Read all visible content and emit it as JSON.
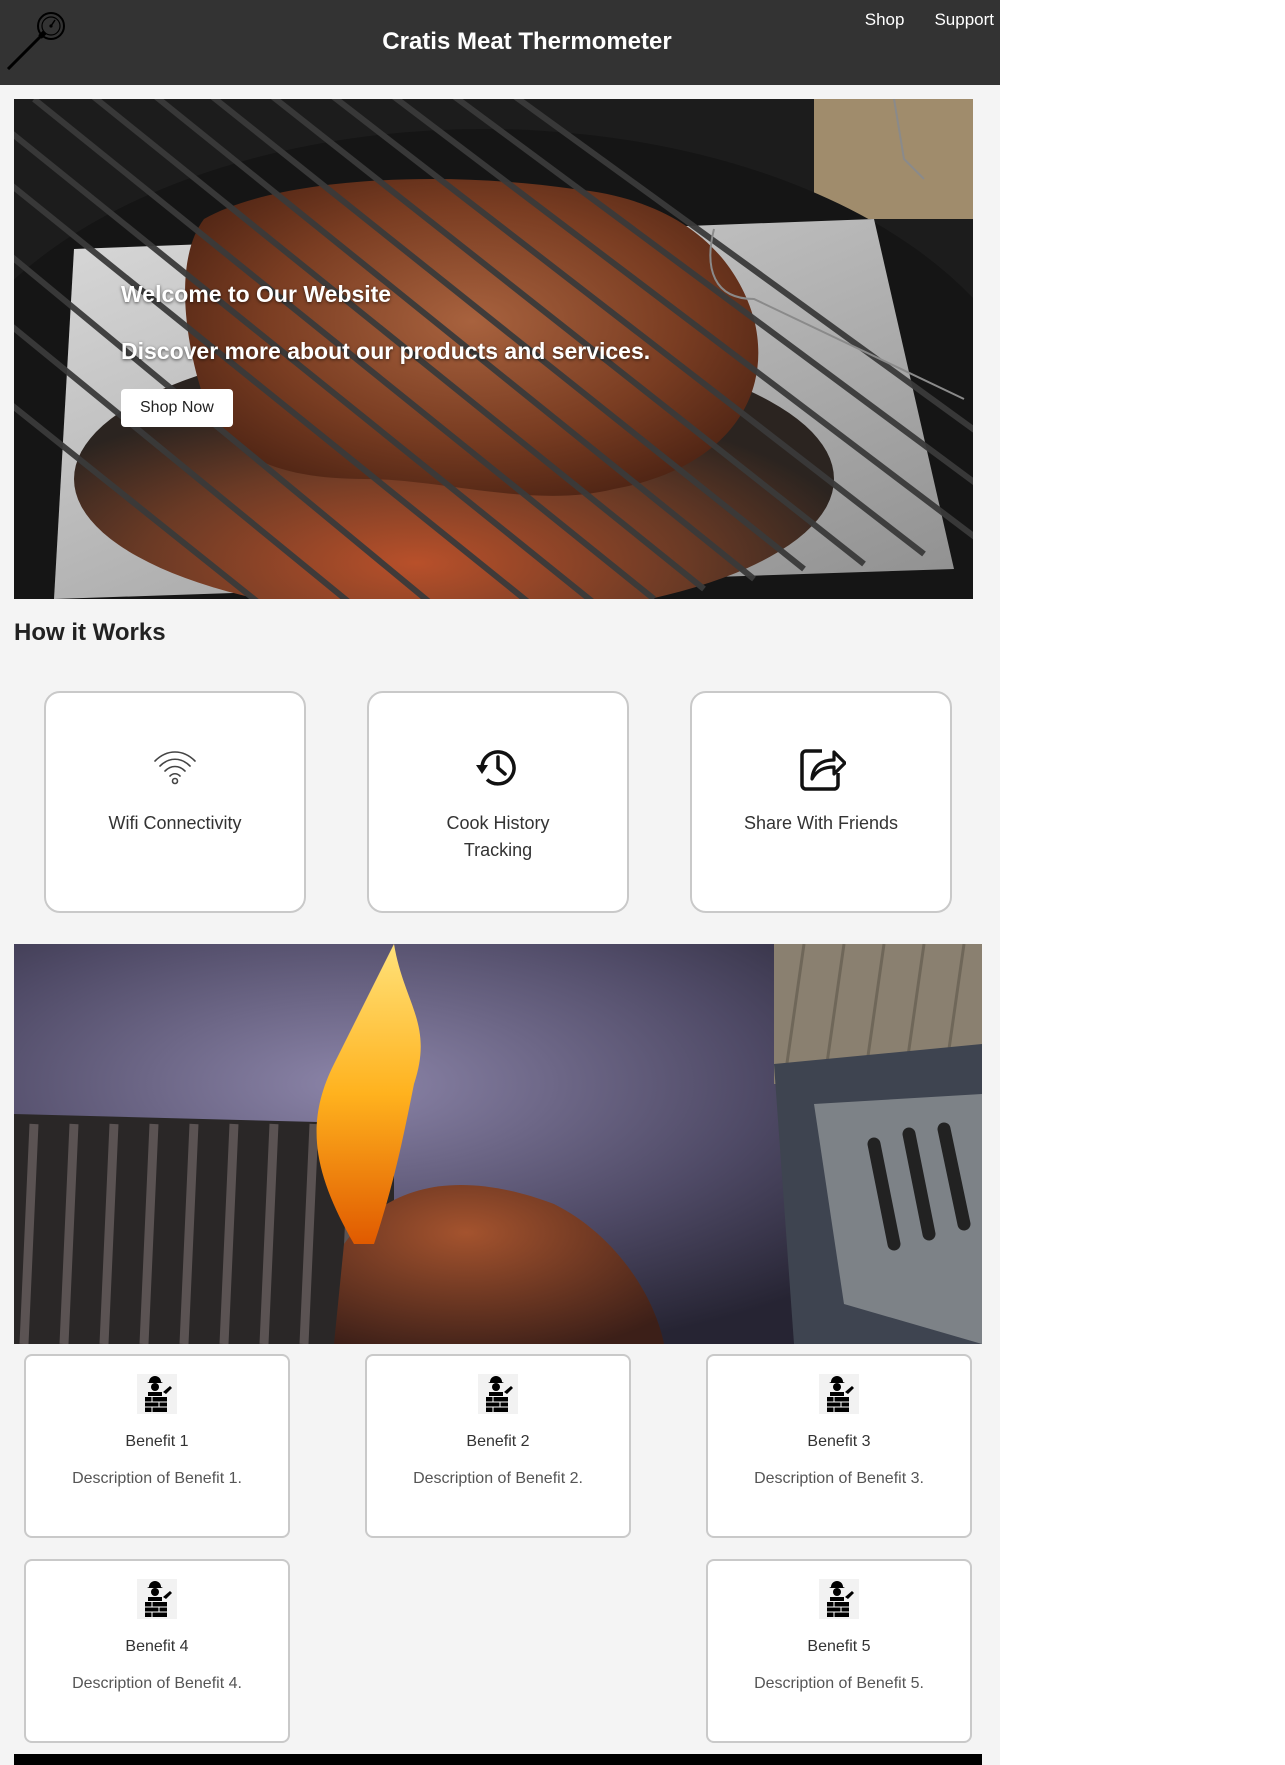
{
  "header": {
    "title": "Cratis Meat Thermometer",
    "nav": [
      {
        "label": "Shop",
        "icon": ""
      },
      {
        "label": "Support",
        "icon": ""
      }
    ],
    "logo_icon": "meat-thermometer-icon"
  },
  "hero": {
    "title": "Welcome to Our Website",
    "subtitle": "Discover more about our products and services.",
    "button_label": "Shop Now"
  },
  "how_it_works": {
    "title": "How it Works",
    "features": [
      {
        "label": "Wifi Connectivity",
        "icon": "wifi-icon"
      },
      {
        "label": "Cook History Tracking",
        "icon": "history-icon"
      },
      {
        "label": "Share With Friends",
        "icon": "share-icon"
      }
    ]
  },
  "benefits": [
    {
      "title": "Benefit 1",
      "description": "Description of Benefit 1.",
      "icon": "worker-icon"
    },
    {
      "title": "Benefit 2",
      "description": "Description of Benefit 2.",
      "icon": "worker-icon"
    },
    {
      "title": "Benefit 3",
      "description": "Description of Benefit 3.",
      "icon": "worker-icon"
    },
    {
      "title": "Benefit 4",
      "description": "Description of Benefit 4.",
      "icon": "worker-icon"
    },
    {
      "title": "Benefit 5",
      "description": "Description of Benefit 5.",
      "icon": "worker-icon"
    }
  ],
  "colors": {
    "header_bg": "#333333",
    "page_bg": "#f4f4f4",
    "card_border": "#c9c9c9"
  }
}
